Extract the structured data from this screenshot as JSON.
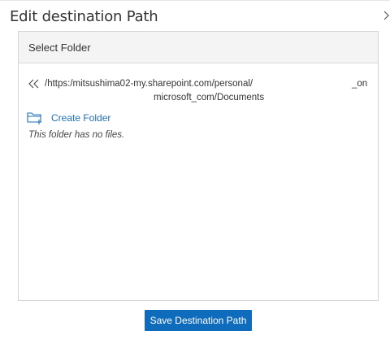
{
  "dialog": {
    "title": "Edit destination Path"
  },
  "panel": {
    "header": "Select Folder",
    "path_line1": "/https:/mitsushima02-my.sharepoint.com/personal/",
    "path_line1_tail": "_on",
    "path_line2": "microsoft_com/Documents",
    "create_folder_label": "Create Folder",
    "empty_message": "This folder has no files."
  },
  "footer": {
    "save_label": "Save Destination Path"
  },
  "icons": {
    "back": "double-chevron-left-icon",
    "new_folder": "folder-add-icon",
    "expand": "chevron-right-icon"
  },
  "colors": {
    "accent": "#0f6cbd",
    "link": "#1f6fb8",
    "header_bg": "#f4f4f4"
  }
}
